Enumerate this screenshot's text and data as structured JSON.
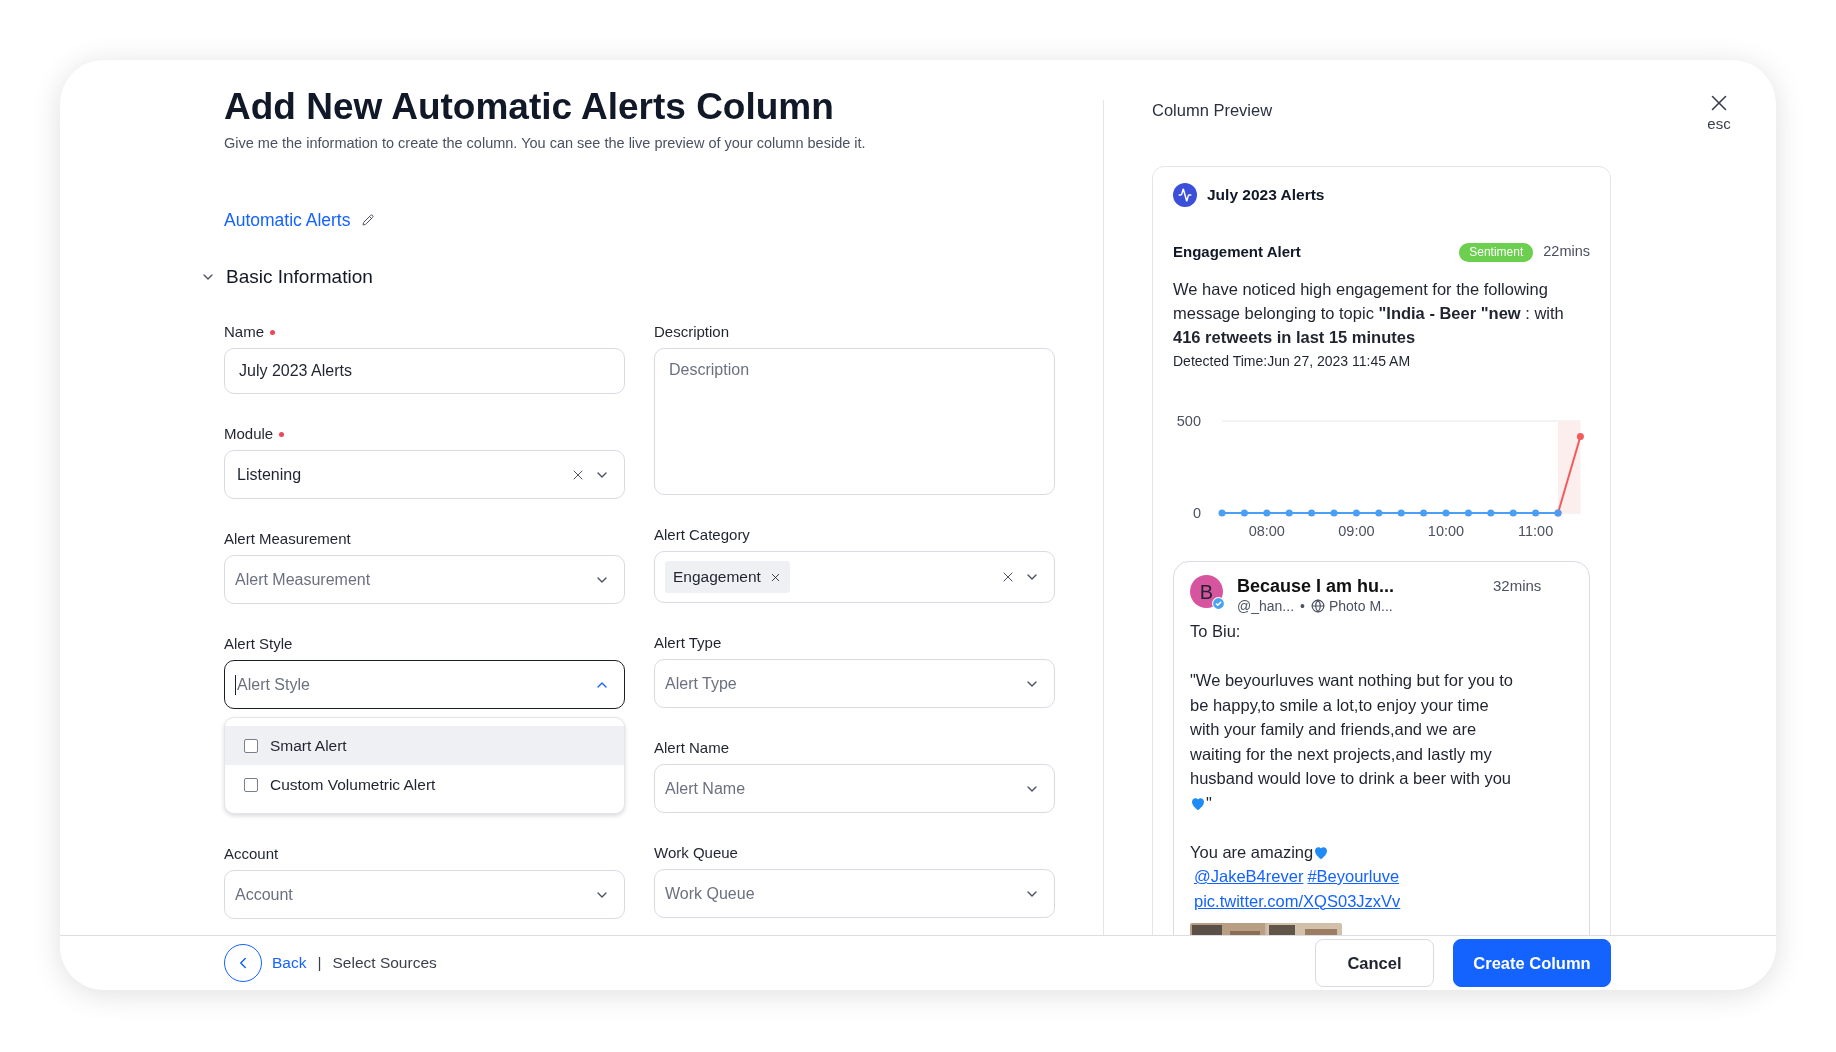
{
  "header": {
    "title": "Add New Automatic Alerts Column",
    "subtitle": "Give me the information to create the column. You can see the live preview of your column beside it."
  },
  "column_name": "Automatic Alerts",
  "section": {
    "title": "Basic Information",
    "expanded": true
  },
  "form": {
    "left": [
      {
        "kind": "text",
        "label": "Name",
        "required": true,
        "value": "July 2023 Alerts"
      },
      {
        "kind": "select",
        "label": "Module",
        "required": true,
        "value": "Listening",
        "clearable": true,
        "open": false
      },
      {
        "kind": "select",
        "label": "Alert Measurement",
        "required": false,
        "placeholder": "Alert Measurement",
        "clearable": false,
        "open": false
      },
      {
        "kind": "select",
        "label": "Alert Style",
        "required": false,
        "placeholder": "Alert Style",
        "clearable": false,
        "open": true,
        "options": [
          {
            "label": "Smart Alert",
            "checked": false,
            "selected": true
          },
          {
            "label": "Custom Volumetric Alert",
            "checked": false,
            "selected": false
          }
        ]
      },
      {
        "kind": "select",
        "label": "Account",
        "required": false,
        "placeholder": "Account",
        "clearable": false,
        "open": false
      }
    ],
    "right": [
      {
        "kind": "textarea",
        "label": "Description",
        "required": false,
        "placeholder": "Description"
      },
      {
        "kind": "select",
        "label": "Alert Category",
        "required": false,
        "tags": [
          "Engagement"
        ],
        "clearable": true,
        "open": false
      },
      {
        "kind": "select",
        "label": "Alert Type",
        "required": false,
        "placeholder": "Alert Type",
        "clearable": false,
        "open": false
      },
      {
        "kind": "select",
        "label": "Alert Name",
        "required": false,
        "placeholder": "Alert Name",
        "clearable": false,
        "open": false
      },
      {
        "kind": "select",
        "label": "Work Queue",
        "required": false,
        "placeholder": "Work Queue",
        "clearable": false,
        "open": false
      }
    ]
  },
  "preview": {
    "title": "Column Preview",
    "close_label": "esc",
    "card": {
      "title": "July 2023 Alerts",
      "alert": {
        "title": "Engagement Alert",
        "tag": "Sentiment",
        "time": "22mins",
        "message": "We have noticed high engagement for the following message belonging to topic **\"India - Beer \"new** : with **416 retweets in last 15 minutes**",
        "detected": "Detected Time:Jun 27, 2023 11:45 AM"
      },
      "chart_data": {
        "type": "line",
        "x": [
          7.5,
          7.75,
          8,
          8.25,
          8.5,
          8.75,
          9,
          9.25,
          9.5,
          9.75,
          10,
          10.25,
          10.5,
          10.75,
          11,
          11.25,
          11.5
        ],
        "series": [
          {
            "color": "#4a9ef5",
            "marker": "circle",
            "values": [
              0,
              0,
              0,
              0,
              0,
              0,
              0,
              0,
              0,
              0,
              0,
              0,
              0,
              0,
              0,
              0,
              null
            ]
          },
          {
            "color": "#f25b5b",
            "marker": "circle",
            "values": [
              null,
              null,
              null,
              null,
              null,
              null,
              null,
              null,
              null,
              null,
              null,
              null,
              null,
              null,
              null,
              0,
              416
            ]
          }
        ],
        "bands": [
          {
            "axis": "x",
            "from": 11.25,
            "to": 11.5,
            "color": "#fdeeee"
          }
        ],
        "xlim": [
          7.5,
          11.5
        ],
        "ylim": [
          0,
          500
        ],
        "yticks": [
          0,
          500
        ],
        "xticks": [
          {
            "value": 8,
            "label": "08:00"
          },
          {
            "value": 9,
            "label": "09:00"
          },
          {
            "value": 10,
            "label": "10:00"
          },
          {
            "value": 11,
            "label": "11:00"
          }
        ]
      },
      "post": {
        "avatar": "B",
        "author": "Because I am hu...",
        "handle": "@_han...",
        "separator": "•",
        "source": "Photo M...",
        "time": "32mins",
        "body": [
          [
            {
              "kind": "text",
              "text": "To Biu:"
            }
          ],
          [
            {
              "kind": "text",
              "text": "\"We beyourluves want nothing but for you to be happy,to smile a lot,to enjoy your time with your family and friends,and we are waiting for the next projects,and lastly my husband would love to drink a beer with you"
            },
            {
              "kind": "break"
            },
            {
              "kind": "heart"
            },
            {
              "kind": "text",
              "text": "\""
            }
          ],
          [
            {
              "kind": "text",
              "text": "You are amazing"
            },
            {
              "kind": "heart"
            },
            {
              "kind": "break"
            },
            {
              "kind": "link",
              "text": "@JakeB4rever"
            },
            {
              "kind": "link",
              "text": "#Beyourluve"
            },
            {
              "kind": "break"
            },
            {
              "kind": "link",
              "text": "pic.twitter.com/XQS03JzxVv"
            }
          ]
        ],
        "media": {
          "kind": "picture"
        }
      }
    }
  },
  "footer": {
    "back": "Back",
    "separator": "|",
    "step": "Select Sources",
    "buttons": [
      {
        "label": "Cancel",
        "kind": "secondary"
      },
      {
        "label": "Create Column",
        "kind": "primary"
      }
    ]
  }
}
